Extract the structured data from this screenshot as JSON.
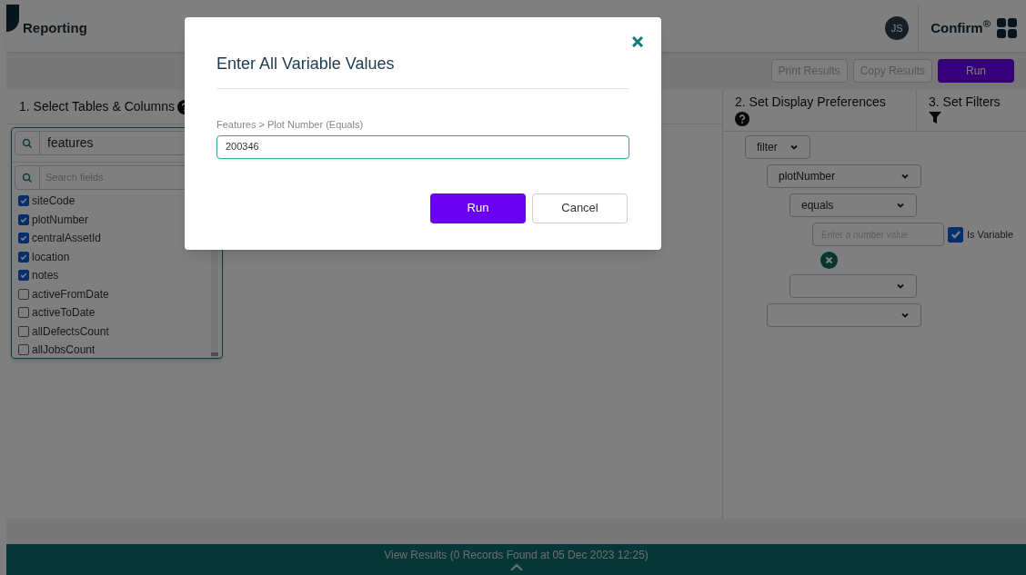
{
  "header": {
    "title": "Reporting",
    "avatar": "JS",
    "brand": "Confirm$^{®}$"
  },
  "toolbar": {
    "buttons": [
      {
        "label": "Print Results",
        "kind": "outline",
        "disabled": true
      },
      {
        "label": "Copy Results",
        "kind": "outline",
        "disabled": true
      },
      {
        "label": "Run",
        "kind": "primary",
        "disabled": false
      }
    ]
  },
  "tables_panel": {
    "title": "1. Select Tables & Columns",
    "table_search": "features",
    "field_search_placeholder": "Search fields",
    "fields": [
      {
        "name": "siteCode",
        "checked": true
      },
      {
        "name": "plotNumber",
        "checked": true
      },
      {
        "name": "centralAssetId",
        "checked": true
      },
      {
        "name": "location",
        "checked": true
      },
      {
        "name": "notes",
        "checked": true
      },
      {
        "name": "activeFromDate",
        "checked": false
      },
      {
        "name": "activeToDate",
        "checked": false
      },
      {
        "name": "allDefectsCount",
        "checked": false
      },
      {
        "name": "allJobsCount",
        "checked": false
      }
    ]
  },
  "tabs": [
    {
      "label": "2. Set Display Preferences",
      "kind": "help"
    },
    {
      "label": "3. Set Filters",
      "kind": "filter"
    }
  ],
  "filter_builder": {
    "group_operator": "filter",
    "field": "plotNumber",
    "operator": "equals",
    "value_placeholder": "Enter a number value",
    "is_variable": {
      "label": "Is Variable",
      "checked": true
    }
  },
  "footer": {
    "text": "View Results (0 Records Found at 05 Dec 2023 12:25)"
  },
  "modal": {
    "title": "Enter All Variable Values",
    "field_label": "Features > Plot Number (Equals)",
    "value": "200346",
    "buttons": [
      {
        "label": "Run",
        "kind": "primary"
      },
      {
        "label": "Cancel",
        "kind": "secondary"
      }
    ]
  }
}
